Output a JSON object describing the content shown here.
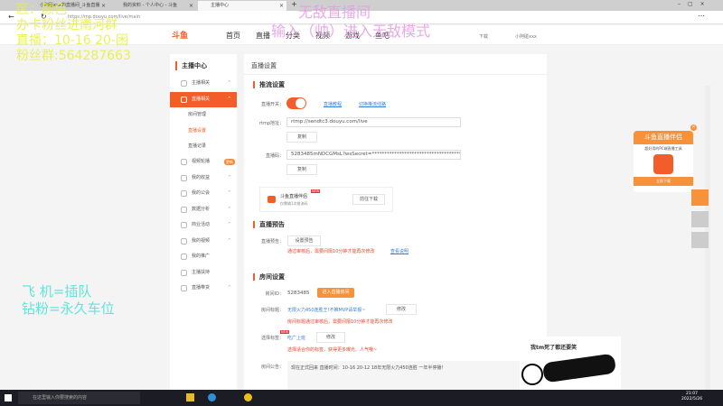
{
  "browser": {
    "tabs": [
      {
        "title": "小阿碰xxx的直播间_斗鱼直播"
      },
      {
        "title": "我的资料 - 个人中心 - 斗鱼"
      },
      {
        "title": "主播中心"
      }
    ],
    "url": "https://mp.douyu.com/live/main"
  },
  "site": {
    "logo": "斗鱼",
    "nav": [
      "首页",
      "直播",
      "分类",
      "视频",
      "游戏",
      "鱼吧"
    ],
    "download": "下载",
    "user": "小阿碰xxx"
  },
  "sidebar": {
    "title": "主播中心",
    "items": [
      {
        "label": "主播相关"
      },
      {
        "label": "直播相关"
      },
      {
        "label": "房间管理"
      },
      {
        "label": "直播设置"
      },
      {
        "label": "直播记录"
      },
      {
        "label": "视频轮播",
        "badge": "更新"
      },
      {
        "label": "我的收益"
      },
      {
        "label": "我的公会"
      },
      {
        "label": "数据分析"
      },
      {
        "label": "商业活动"
      },
      {
        "label": "我的视频"
      },
      {
        "label": "我的推广"
      },
      {
        "label": "主播扶持"
      },
      {
        "label": "直播带货"
      }
    ]
  },
  "main": {
    "title": "直播设置",
    "push": {
      "heading": "推流设置",
      "switch_label": "直播开关：",
      "switch_on": true,
      "tutorial": "直播教程",
      "switch_line": "切换推流线路",
      "rtmp_label": "rtmp地址：",
      "rtmp": "rtmp://sendtc3.douyu.com/live",
      "copy": "复制",
      "code_label": "直播码：",
      "code": "5283485mNDCGMsL?wsSecret=************************************&aws",
      "promo_title": "斗鱼直播伴侣",
      "promo_new": "NEW",
      "promo_sub": "仅需输1次推流码",
      "promo_btn": "前往下载"
    },
    "notice": {
      "heading": "直播预告",
      "label": "直播预告：",
      "btn": "设置预告",
      "hint": "通过审核后，需要间隔10分钟才能再次修改",
      "link": "查看说明"
    },
    "room": {
      "heading": "房间设置",
      "id_label": "房间ID：",
      "id": "5283485",
      "enter": "进入直播房间",
      "title_label": "房间标题：",
      "title": "无限火力450连胜王!不推MVP请举报~",
      "modify": "修改",
      "title_hint": "房间标题通过审核后，需要间隔10分钟才能再次修改",
      "tag_label": "选择标签：",
      "tag_new": "NEW",
      "tag": "吃广上班",
      "tag_hint": "选择适合你的标签，获得更多曝光、人气哦~",
      "ann_label": "房间公告：",
      "ann": "现在正式回来 直播时间：10-16 20-12 18年无限火力450连胜 一年半停播！"
    }
  },
  "float_ad": {
    "title": "斗鱼直播伴侣",
    "sub": "超好用的PC端直播工具",
    "btn": "立即下载"
  },
  "overlays": {
    "yellow": [
      "区：颜色",
      "办卡粉丝进南河群",
      "直播：10-16 20-困",
      "粉丝群:564287663"
    ],
    "pink": [
      "无敌直播间",
      "输入（帅）进入无敌模式"
    ],
    "cyan": [
      "飞 机=插队",
      "钻粉=永久车位"
    ],
    "meme": "我tm死了都还要笑"
  },
  "taskbar": {
    "search": "在这里输入你要搜索的内容",
    "time": "21:07",
    "date": "2022/5/26"
  },
  "colors": {
    "accent": "#f25d2a"
  }
}
